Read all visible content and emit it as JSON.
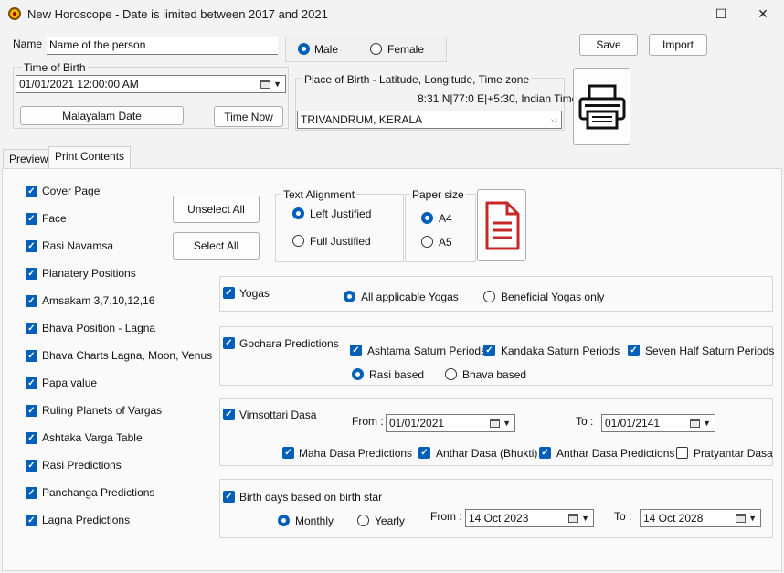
{
  "window": {
    "title": "New Horoscope - Date is limited between 2017 and 2021",
    "minimize": "—",
    "maximize": "☐",
    "close": "✕"
  },
  "header": {
    "name_label": "Name",
    "name_value": "Name of the person",
    "gender": {
      "male": "Male",
      "female": "Female",
      "selected": "Male"
    },
    "save": "Save",
    "import": "Import",
    "time_of_birth_label": "Time of Birth",
    "time_of_birth_value": "01/01/2021  12:00:00 AM",
    "malayalam_date": "Malayalam Date",
    "time_now": "Time Now",
    "place_label": "Place of Birth - Latitude, Longitude, Time zone",
    "coords": "8:31 N|77:0 E|+5:30, Indian Time",
    "place_value": "TRIVANDRUM, KERALA"
  },
  "tabs": [
    "Preview",
    "Print Contents"
  ],
  "print_contents": {
    "items": [
      "Cover Page",
      "Face",
      "Rasi  Navamsa",
      "Planatery Positions",
      "Amsakam 3,7,10,12,16",
      "Bhava Position - Lagna",
      "Bhava Charts Lagna, Moon, Venus",
      "Papa value",
      "Ruling Planets of Vargas",
      "Ashtaka Varga Table",
      "Rasi Predictions",
      "Panchanga Predictions",
      "Lagna Predictions"
    ],
    "unselect_all": "Unselect All",
    "select_all": "Select All",
    "text_alignment": {
      "label": "Text Alignment",
      "left": "Left Justified",
      "full": "Full Justified",
      "selected": "Left Justified"
    },
    "paper_size": {
      "label": "Paper size",
      "a4": "A4",
      "a5": "A5",
      "selected": "A4"
    }
  },
  "yogas": {
    "label": "Yogas",
    "all": "All applicable Yogas",
    "beneficial": "Beneficial Yogas only",
    "selected": "All applicable Yogas"
  },
  "gochara": {
    "label": "Gochara Predictions",
    "ashtama": "Ashtama Saturn Periods",
    "kandaka": "Kandaka Saturn Periods",
    "seven_half": "Seven Half Saturn Periods",
    "rasi_based": "Rasi based",
    "bhava_based": "Bhava based",
    "selected": "Rasi based"
  },
  "vimsottari": {
    "label": "Vimsottari Dasa",
    "from_label": "From :",
    "from_value": "01/01/2021",
    "to_label": "To :",
    "to_value": "01/01/2141",
    "maha": "Maha Dasa Predictions",
    "anthar_bhukti": "Anthar Dasa (Bhukti)",
    "anthar_pred": "Anthar Dasa Predictions",
    "pratyantar": "Pratyantar Dasa"
  },
  "birthdays": {
    "label": "Birth days based on birth star",
    "monthly": "Monthly",
    "yearly": "Yearly",
    "selected": "Monthly",
    "from_label": "From :",
    "from_value": "14 Oct  2023",
    "to_label": "To :",
    "to_value": "14 Oct  2028"
  },
  "icons": [
    "app-icon",
    "printer-icon",
    "document-icon",
    "calendar-icon",
    "chevron-down-icon"
  ]
}
